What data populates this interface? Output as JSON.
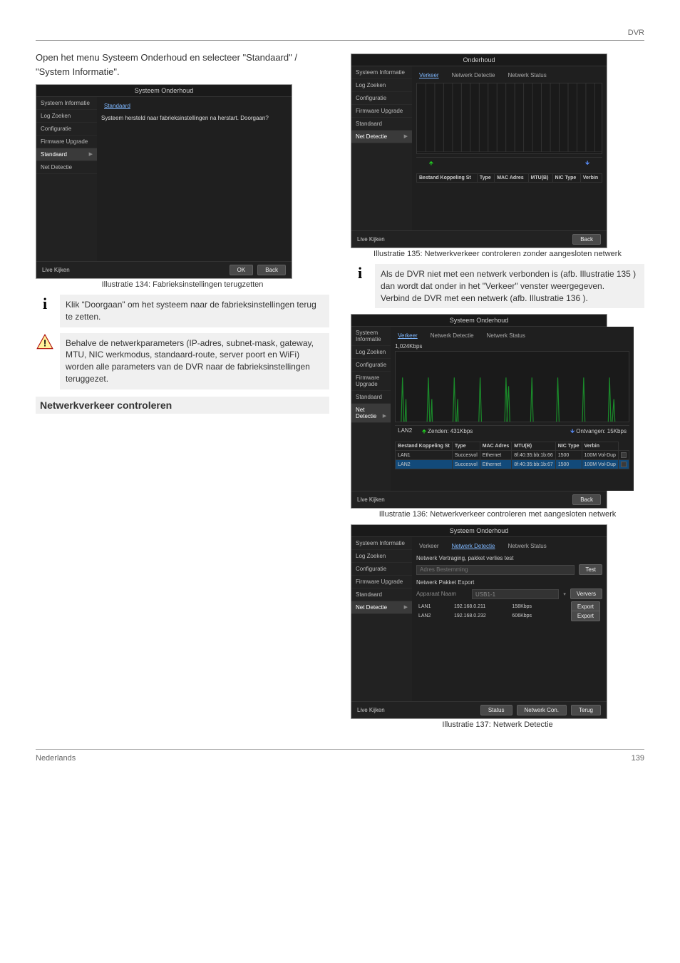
{
  "header": {
    "top_right": "DVR"
  },
  "left": {
    "intro": "Open het menu Systeem Onderhoud en selecteer \"Standaard\" / \"System Informatie\".",
    "fig1": {
      "titlebar": "Systeem Onderhoud",
      "menu": [
        "Systeem Informatie",
        "Log Zoeken",
        "Configuratie",
        "Firmware Upgrade",
        "Standaard",
        "Net Detectie"
      ],
      "tab_active": "Standaard",
      "msg": "Systeem hersteld naar fabrieksinstellingen na herstart. Doorgaan?",
      "live": "Live Kijken",
      "ok": "OK",
      "back": "Back"
    },
    "caption1": "Illustratie 134: Fabrieksinstellingen terugzetten",
    "note1": "Klik “Doorgaan\" om het systeem naar de fabrieksinstellingen terug te zetten.",
    "warn": "Behalve de netwerkparameters (IP-adres, subnet-mask, gateway, MTU, NIC werkmodus, standaard-route, server poort en WiFi) worden alle parameters van de DVR naar de fabrieksinstellingen teruggezet.",
    "section_title": "Netwerkverkeer controleren"
  },
  "right": {
    "caption2": "Illustratie 135: Netwerkverkeer controleren zonder aangesloten netwerk",
    "fig2": {
      "titlebar": "Onderhoud",
      "menu": [
        "Systeem Informatie",
        "Log Zoeken",
        "Configuratie",
        "Firmware Upgrade",
        "Standaard",
        "Net Detectie"
      ],
      "tabs": [
        "Verkeer",
        "Netwerk Detectie",
        "Netwerk Status"
      ],
      "live": "Live Kijken",
      "back": "Back",
      "table_head": [
        "Bestand Koppeling St",
        "Type",
        "MAC Adres",
        "MTU(B)",
        "NIC Type",
        "Verbin"
      ]
    },
    "note2_a": "Als de DVR niet met een netwerk verbonden is (afb. Illustratie 135 ) dan wordt dat onder in het \"Verkeer\" venster weergegeven.",
    "note2_b": "Verbind de DVR met een netwerk (afb. Illustratie 136 ).",
    "fig3": {
      "titlebar": "Systeem Onderhoud",
      "menu": [
        "Systeem Informatie",
        "Log Zoeken",
        "Configuratie",
        "Firmware Upgrade",
        "Standaard",
        "Net Detectie"
      ],
      "tabs": [
        "Verkeer",
        "Netwerk Detectie",
        "Netwerk Status"
      ],
      "rate_top": "1,024Kbps",
      "lan_info_name": "LAN2",
      "lan_send": "Zenden: 431Kbps",
      "lan_recv": "Ontvangen: 15Kbps",
      "table_head": [
        "Bestand Koppeling St",
        "Type",
        "MAC Adres",
        "MTU(B)",
        "NIC Type",
        "Verbin"
      ],
      "rows": [
        [
          "LAN1",
          "Succesvol",
          "Ethernet",
          "8f:40:35:bb:1b:66",
          "1500",
          "100M Vol-Dup",
          ""
        ],
        [
          "LAN2",
          "Succesvol",
          "Ethernet",
          "8f:40:35:bb:1b:67",
          "1500",
          "100M Vol-Dup",
          ""
        ]
      ],
      "live": "Live Kijken",
      "back": "Back"
    },
    "caption3": "Illustratie 136: Netwerkverkeer controleren met aangesloten netwerk",
    "fig4": {
      "titlebar": "Systeem Onderhoud",
      "menu": [
        "Systeem Informatie",
        "Log Zoeken",
        "Configuratie",
        "Firmware Upgrade",
        "Standaard",
        "Net Detectie"
      ],
      "tabs": [
        "Verkeer",
        "Netwerk Detectie",
        "Netwerk Status"
      ],
      "hdr1": "Netwerk Vertraging, pakket verlies test",
      "addr_placeholder": "Adres Bestemming",
      "test_btn": "Test",
      "hdr2": "Netwerk Pakket Export",
      "app_label": "Apparaat Naam",
      "app_value": "USB1-1",
      "refresh_btn": "Ververs",
      "rows": [
        [
          "LAN1",
          "192.168.0.211",
          "158Kbps",
          "Export"
        ],
        [
          "LAN2",
          "192.168.0.232",
          "606Kbps",
          "Export"
        ]
      ],
      "live": "Live Kijken",
      "status": "Status",
      "netcon": "Netwerk Con.",
      "back": "Terug"
    },
    "caption4": "Illustratie 137: Netwerk Detectie"
  },
  "footer": {
    "left": "Nederlands",
    "right": "139"
  }
}
